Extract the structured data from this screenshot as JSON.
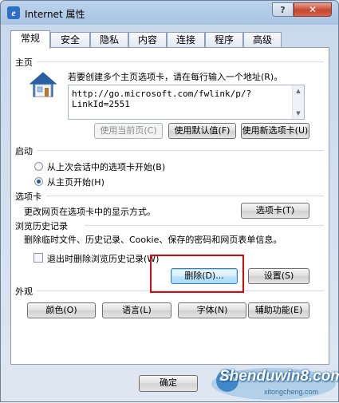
{
  "window": {
    "title": "Internet 属性",
    "help_button": "?",
    "close_button": "✕"
  },
  "tabs": [
    {
      "label": "常规",
      "active": true
    },
    {
      "label": "安全"
    },
    {
      "label": "隐私"
    },
    {
      "label": "内容"
    },
    {
      "label": "连接"
    },
    {
      "label": "程序"
    },
    {
      "label": "高级"
    }
  ],
  "homepage": {
    "section_title": "主页",
    "description": "若要创建多个主页选项卡，请在每行输入一个地址(R)。",
    "url": "http://go.microsoft.com/fwlink/p/?LinkId=2551",
    "buttons": {
      "use_current": "使用当前页(C)",
      "use_default": "使用默认值(F)",
      "use_new_tab": "使用新选项卡(U)"
    }
  },
  "startup": {
    "section_title": "启动",
    "option_last_session": "从上次会话中的选项卡开始(B)",
    "option_homepage": "从主页开始(H)",
    "selected": "homepage"
  },
  "tabs_section": {
    "section_title": "选项卡",
    "description": "更改网页在选项卡中的显示方式。",
    "button": "选项卡(T)"
  },
  "history": {
    "section_title": "浏览历史记录",
    "description": "删除临时文件、历史记录、Cookie、保存的密码和网页表单信息。",
    "delete_on_exit": "退出时删除浏览历史记录(W)",
    "delete_on_exit_checked": false,
    "delete_button": "删除(D)...",
    "settings_button": "设置(S)"
  },
  "appearance": {
    "section_title": "外观",
    "buttons": [
      "颜色(O)",
      "语言(L)",
      "字体(N)",
      "辅助功能(E)"
    ]
  },
  "footer": {
    "ok_button": "确定"
  },
  "watermark": {
    "title": "Shenduwin8.com",
    "subtitle": "xitongcheng.com"
  },
  "colors": {
    "highlight_box": "#d60a0a",
    "close_button": "#c7462f"
  }
}
